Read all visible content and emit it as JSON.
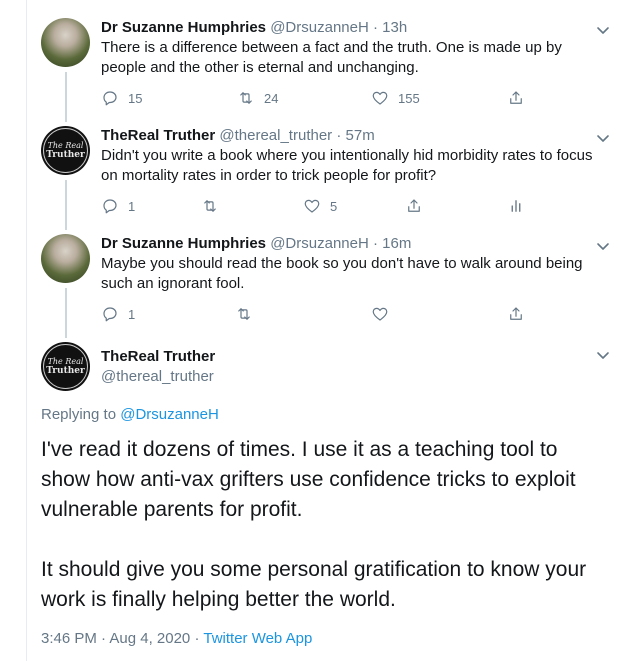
{
  "tweets": [
    {
      "name": "Dr Suzanne Humphries",
      "handle": "@DrsuzanneH",
      "sep": "·",
      "time": "13h",
      "text": "There is a difference between a fact and the truth. One is made up by people and the other is eternal and unchanging.",
      "reply_count": "15",
      "retweet_count": "24",
      "like_count": "155"
    },
    {
      "name": "TheReal Truther",
      "handle": "@thereal_truther",
      "sep": "·",
      "time": "57m",
      "text": "Didn't you write a book where you intentionally hid morbidity rates to focus on mortality rates in order to trick people for profit?",
      "reply_count": "1",
      "retweet_count": "",
      "like_count": "5"
    },
    {
      "name": "Dr Suzanne Humphries",
      "handle": "@DrsuzanneH",
      "sep": "·",
      "time": "16m",
      "text": "Maybe you should read the book so you don't have to walk around being such an ignorant fool.",
      "reply_count": "1",
      "retweet_count": "",
      "like_count": ""
    }
  ],
  "truther_avatar": {
    "line1": "The Real",
    "line2": "Truther"
  },
  "main_tweet": {
    "name": "TheReal Truther",
    "handle": "@thereal_truther",
    "replying_prefix": "Replying to",
    "replying_to": "@DrsuzanneH",
    "paragraph1": "I've read it dozens of times. I use it as a teaching tool to show how anti-vax grifters use confidence tricks to exploit vulnerable parents for profit.",
    "paragraph2": "It should give you some personal gratification to know your work is finally helping better the world.",
    "timestamp": "3:46 PM · Aug 4, 2020",
    "sep": "·",
    "app": "Twitter Web App"
  },
  "colors": {
    "text": "#14171a",
    "secondary": "#657786",
    "link": "#1b95e0",
    "thread_line": "#ccd6dd"
  },
  "icons": [
    "reply-icon",
    "retweet-icon",
    "like-icon",
    "share-icon",
    "analytics-icon",
    "chevron-down-icon"
  ]
}
